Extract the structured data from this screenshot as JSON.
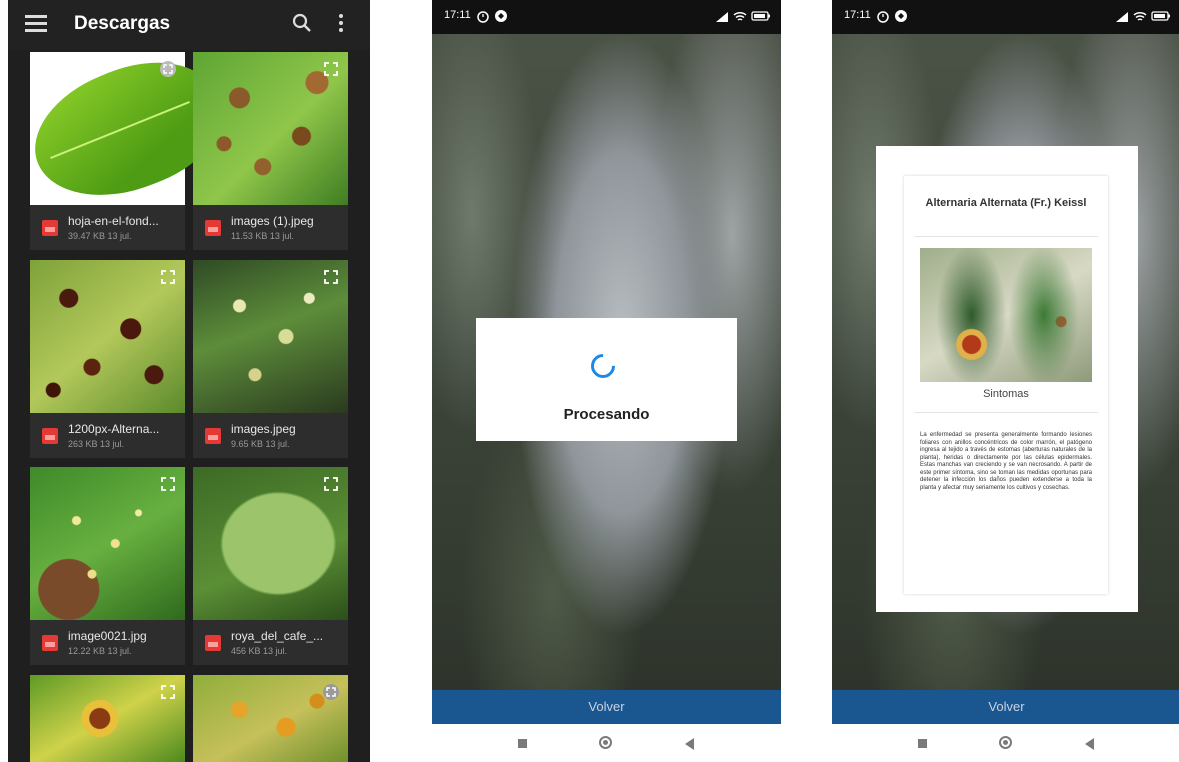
{
  "downloads": {
    "title": "Descargas",
    "files": [
      {
        "name": "hoja-en-el-fond...",
        "meta": "39.47 KB 13 jul."
      },
      {
        "name": "images (1).jpeg",
        "meta": "11.53 KB 13 jul."
      },
      {
        "name": "1200px-Alterna...",
        "meta": "263 KB 13 jul."
      },
      {
        "name": "images.jpeg",
        "meta": "9.65 KB 13 jul."
      },
      {
        "name": "image0021.jpg",
        "meta": "12.22 KB 13 jul."
      },
      {
        "name": "roya_del_cafe_...",
        "meta": "456 KB 13 jul."
      }
    ]
  },
  "processing_screen": {
    "time": "17:11",
    "dialog_text": "Procesando",
    "back_label": "Volver"
  },
  "result_screen": {
    "time": "17:11",
    "disease_title": "Alternaria Alternata (Fr.) Keissl",
    "section_label": "Sintomas",
    "description": "La enfermedad se presenta generalmente formando lesiones foliares con anillos concéntricos de color marrón, el patógeno ingresa al tejido a través de estomas (aberturas naturales de la planta), heridas o directamente por las células epidermales. Estas manchas van creciendo y se van necrosando. A partir de este primer síntoma, sino se toman las medidas oportunas para detener la infección los daños pueden extenderse a toda la planta y afectar muy seriamente los cultivos y cosechas.",
    "back_label": "Volver"
  },
  "colors": {
    "bottom_bar": "#1a5690",
    "spinner": "#1e88e5",
    "file_icon": "#e53935"
  }
}
